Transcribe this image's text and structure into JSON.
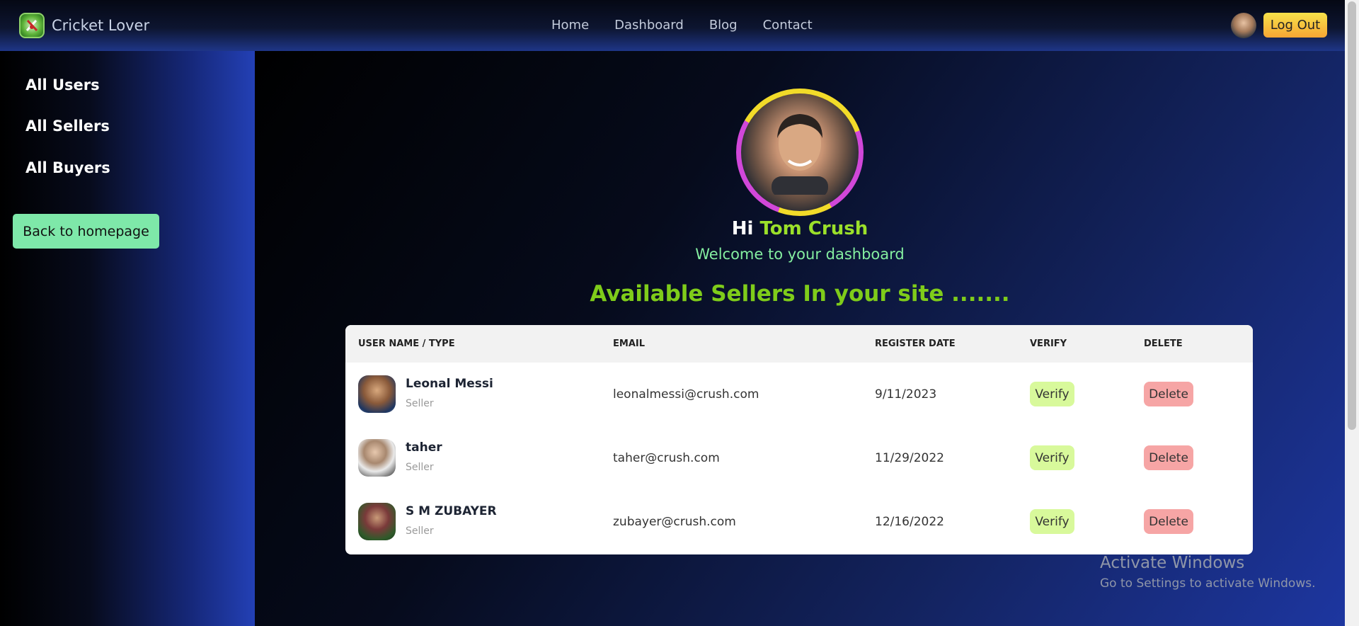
{
  "navbar": {
    "brand": "Cricket Lover",
    "links": [
      "Home",
      "Dashboard",
      "Blog",
      "Contact"
    ],
    "logout_label": "Log Out"
  },
  "sidebar": {
    "items": [
      "All Users",
      "All Sellers",
      "All Buyers"
    ],
    "home_button": "Back to homepage"
  },
  "profile": {
    "greeting": "Hi",
    "name": "Tom Crush",
    "welcome": "Welcome to your dashboard"
  },
  "heading": "Available Sellers In your site .......",
  "table": {
    "headers": [
      "USER NAME / TYPE",
      "EMAIL",
      "REGISTER DATE",
      "VERIFY",
      "DELETE"
    ],
    "rows": [
      {
        "name": "Leonal Messi",
        "type": "Seller",
        "email": "leonalmessi@crush.com",
        "date": "9/11/2023",
        "verify": "Verify",
        "delete": "Delete"
      },
      {
        "name": "taher",
        "type": "Seller",
        "email": "taher@crush.com",
        "date": "11/29/2022",
        "verify": "Verify",
        "delete": "Delete"
      },
      {
        "name": "S M ZUBAYER",
        "type": "Seller",
        "email": "zubayer@crush.com",
        "date": "12/16/2022",
        "verify": "Verify",
        "delete": "Delete"
      }
    ]
  },
  "watermark": {
    "title": "Activate Windows",
    "subtitle": "Go to Settings to activate Windows."
  },
  "colors": {
    "accent_green": "#9be02a",
    "logout_yellow": "#f6e24a",
    "verify_bg": "#d8f99b",
    "delete_bg": "#f6a5a5",
    "home_button_bg": "#7ee8a9"
  },
  "icons": [
    "cricket-logo-icon",
    "user-avatar-icon"
  ]
}
